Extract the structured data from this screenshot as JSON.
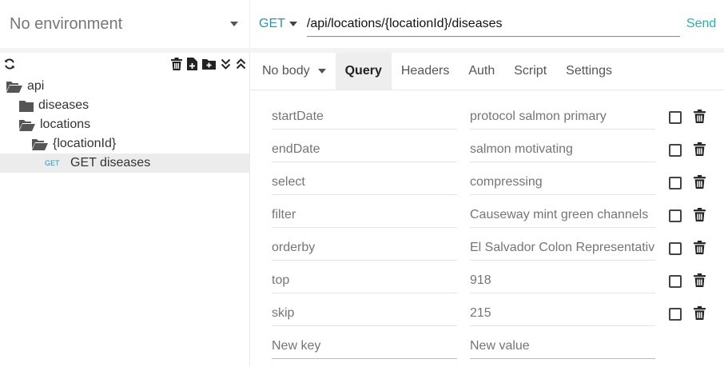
{
  "environment": {
    "label": "No environment"
  },
  "request": {
    "method": "GET",
    "url": "/api/locations/{locationId}/diseases",
    "send_label": "Send"
  },
  "tree": {
    "items": [
      {
        "label": "api",
        "kind": "folder-open"
      },
      {
        "label": "diseases",
        "kind": "folder"
      },
      {
        "label": "locations",
        "kind": "folder-open"
      },
      {
        "label": "{locationId}",
        "kind": "folder-open"
      },
      {
        "label": "GET diseases",
        "kind": "request",
        "badge": "GET"
      }
    ]
  },
  "tabs": {
    "body": "No body",
    "query": "Query",
    "headers": "Headers",
    "auth": "Auth",
    "script": "Script",
    "settings": "Settings"
  },
  "query": {
    "params": [
      {
        "key": "startDate",
        "value": "protocol salmon primary"
      },
      {
        "key": "endDate",
        "value": "salmon motivating"
      },
      {
        "key": "select",
        "value": "compressing"
      },
      {
        "key": "filter",
        "value": "Causeway mint green channels"
      },
      {
        "key": "orderby",
        "value": "El Salvador Colon Representative"
      },
      {
        "key": "top",
        "value": "918"
      },
      {
        "key": "skip",
        "value": "215"
      }
    ],
    "new_key_placeholder": "New key",
    "new_value_placeholder": "New value"
  },
  "colors": {
    "accent_blue": "#2a94b8",
    "send_teal": "#22b3a8"
  }
}
